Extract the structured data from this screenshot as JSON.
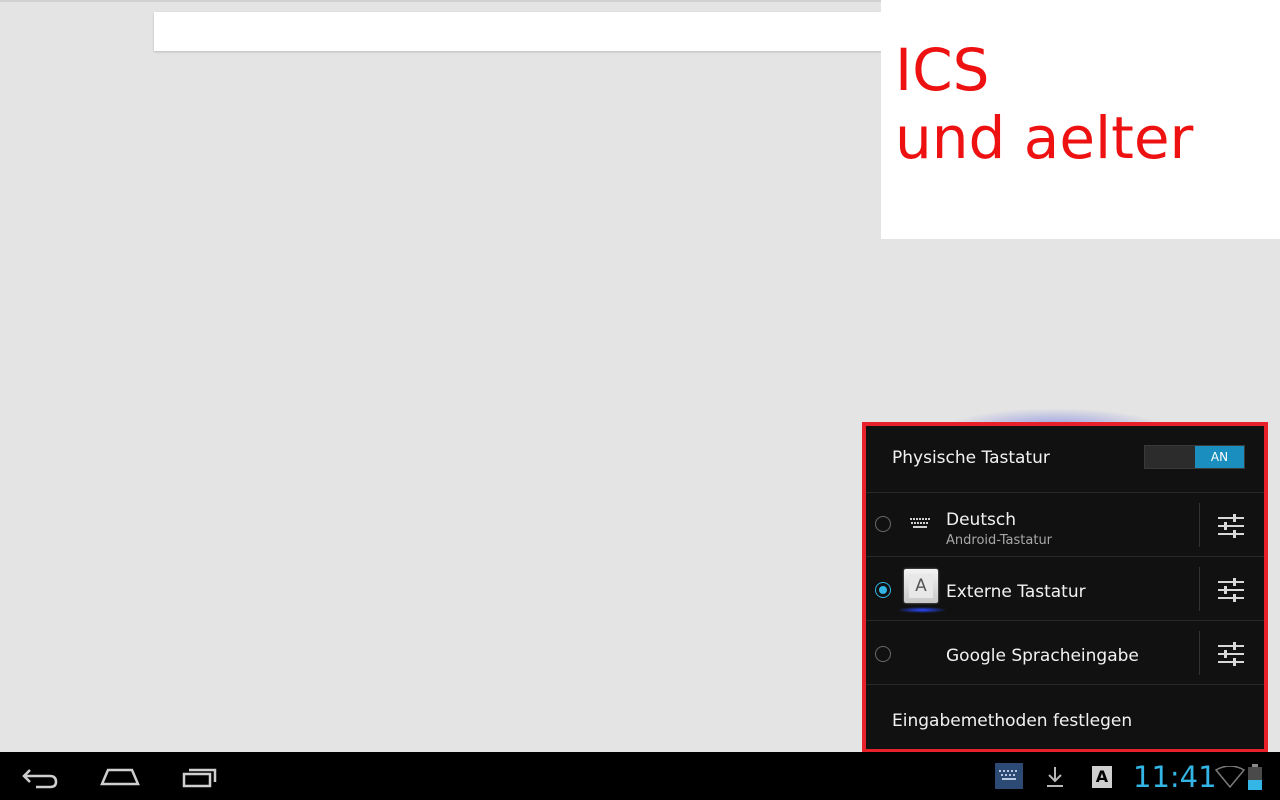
{
  "annotation": {
    "line1": "ICS",
    "line2": "und aelter",
    "color": "#ee1111"
  },
  "ime_panel": {
    "physical_keyboard": {
      "label": "Physische Tastatur",
      "toggle_label": "AN"
    },
    "methods": [
      {
        "title": "Deutsch",
        "subtitle": "Android-Tastatur",
        "selected": false,
        "icon": "keyboard-icon"
      },
      {
        "title": "Externe Tastatur",
        "subtitle": "",
        "selected": true,
        "icon": "external-keyboard-icon",
        "icon_letter": "A"
      },
      {
        "title": "Google Spracheingabe",
        "subtitle": "",
        "selected": false,
        "icon": ""
      }
    ],
    "setup_label": "Eingabemethoden festlegen",
    "border_color": "#e8202a"
  },
  "navbar": {
    "clock": "11:41",
    "tray_letter": "A",
    "accent": "#33b5e5"
  }
}
